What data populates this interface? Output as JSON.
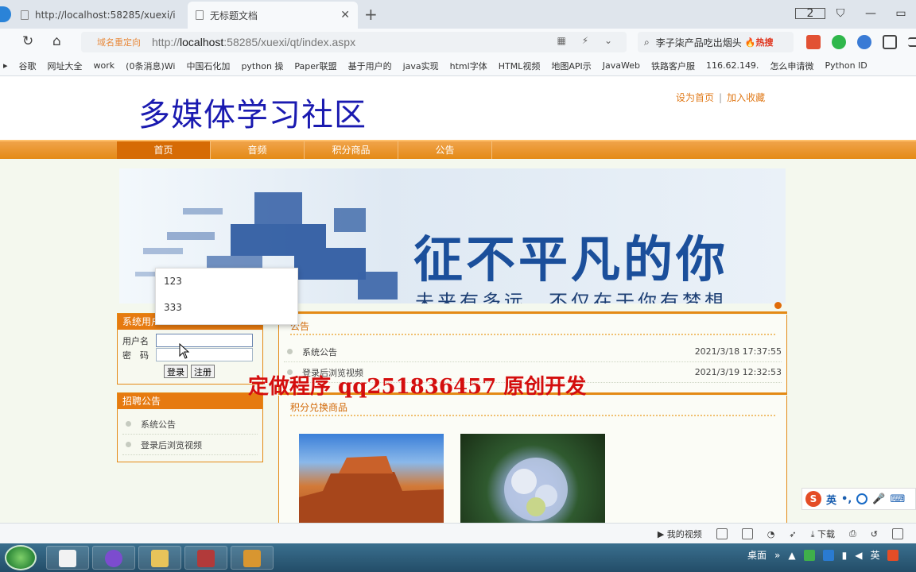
{
  "browser": {
    "tabs": [
      {
        "title": "http://localhost:58285/xuexi/i"
      },
      {
        "title": "无标题文档"
      }
    ],
    "address": {
      "redirect_label": "域名重定向",
      "url_prefix": "http://",
      "url_host": "localhost",
      "url_rest": ":58285/xuexi/qt/index.aspx"
    },
    "search_text": "李子柒产品吃出烟头",
    "search_hot": "热搜",
    "bookmarks": [
      "谷歌",
      "网址大全",
      "work",
      "(0条消息)Wi",
      "中国石化加",
      "python 操",
      "Paper联盟",
      "基于用户的",
      "java实现",
      "html字体",
      "HTML视频",
      "地图API示",
      "JavaWeb",
      "铁路客户服",
      "116.62.149.",
      "怎么申请微",
      "Python ID"
    ]
  },
  "site": {
    "title": "多媒体学习社区",
    "links": {
      "home": "设为首页",
      "fav": "加入收藏",
      "sep": "|"
    },
    "nav": [
      "首页",
      "音频",
      "积分商品",
      "公告"
    ],
    "banner": {
      "slogan": "征不平凡的你",
      "sub": "未来有多远，不仅在于你有梦想"
    }
  },
  "login": {
    "header": "系统用户",
    "username_label": "用户名",
    "password_label": "密　码",
    "login_btn": "登录",
    "register_btn": "注册",
    "autocomplete": [
      "123",
      "333"
    ]
  },
  "recruit": {
    "header": "招聘公告",
    "items": [
      "系统公告",
      "登录后浏览视频"
    ]
  },
  "notice": {
    "header": "公告",
    "items": [
      {
        "name": "系统公告",
        "date": "2021/3/18 17:37:55"
      },
      {
        "name": "登录后浏览视频",
        "date": "2021/3/19 12:32:53"
      }
    ]
  },
  "mall": {
    "header": "积分兑换商品"
  },
  "watermark": "定做程序 qq251836457 原创开发",
  "ime": {
    "lang": "英"
  },
  "statusbar": {
    "video": "我的视频",
    "download": "下载"
  },
  "taskbar": {
    "desktop": "桌面",
    "lang": "英"
  }
}
